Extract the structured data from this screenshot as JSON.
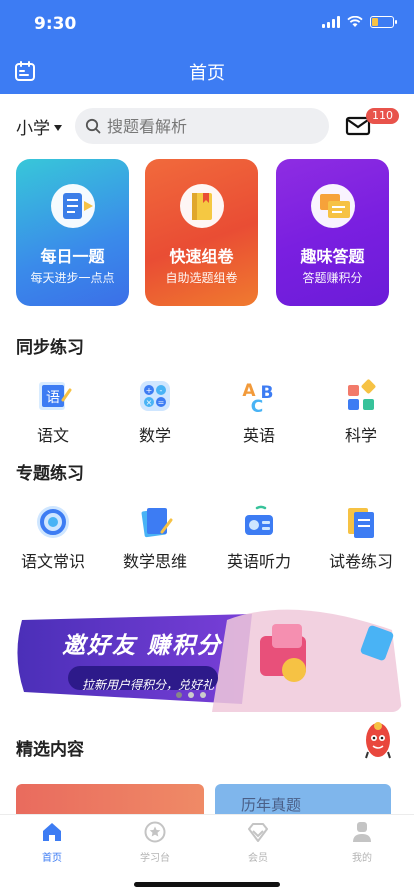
{
  "status": {
    "time": "9:30"
  },
  "nav": {
    "title": "首页"
  },
  "search": {
    "grade": "小学",
    "placeholder": "搜题看解析",
    "mail_count": "110"
  },
  "features": [
    {
      "title": "每日一题",
      "subtitle": "每天进步一点点"
    },
    {
      "title": "快速组卷",
      "subtitle": "自助选题组卷"
    },
    {
      "title": "趣味答题",
      "subtitle": "答题赚积分"
    }
  ],
  "sync_section": {
    "title": "同步练习",
    "items": [
      {
        "label": "语文",
        "icon": "chinese-book-icon"
      },
      {
        "label": "数学",
        "icon": "calculator-icon"
      },
      {
        "label": "英语",
        "icon": "abc-blocks-icon"
      },
      {
        "label": "科学",
        "icon": "science-blocks-icon"
      }
    ]
  },
  "topic_section": {
    "title": "专题练习",
    "items": [
      {
        "label": "语文常识",
        "icon": "globe-icon"
      },
      {
        "label": "数学思维",
        "icon": "notebook-icon"
      },
      {
        "label": "英语听力",
        "icon": "radio-icon"
      },
      {
        "label": "试卷练习",
        "icon": "exam-paper-icon"
      }
    ]
  },
  "banner": {
    "title": "邀好友 赚积分",
    "subtitle": "拉新用户得积分，兑好礼"
  },
  "featured": {
    "title": "精选内容",
    "card_label": "历年真题"
  },
  "tabs": [
    {
      "label": "首页",
      "active": true
    },
    {
      "label": "学习台",
      "active": false
    },
    {
      "label": "会员",
      "active": false
    },
    {
      "label": "我的",
      "active": false
    }
  ],
  "colors": {
    "primary": "#3d7cf3",
    "badge": "#e8534b"
  }
}
